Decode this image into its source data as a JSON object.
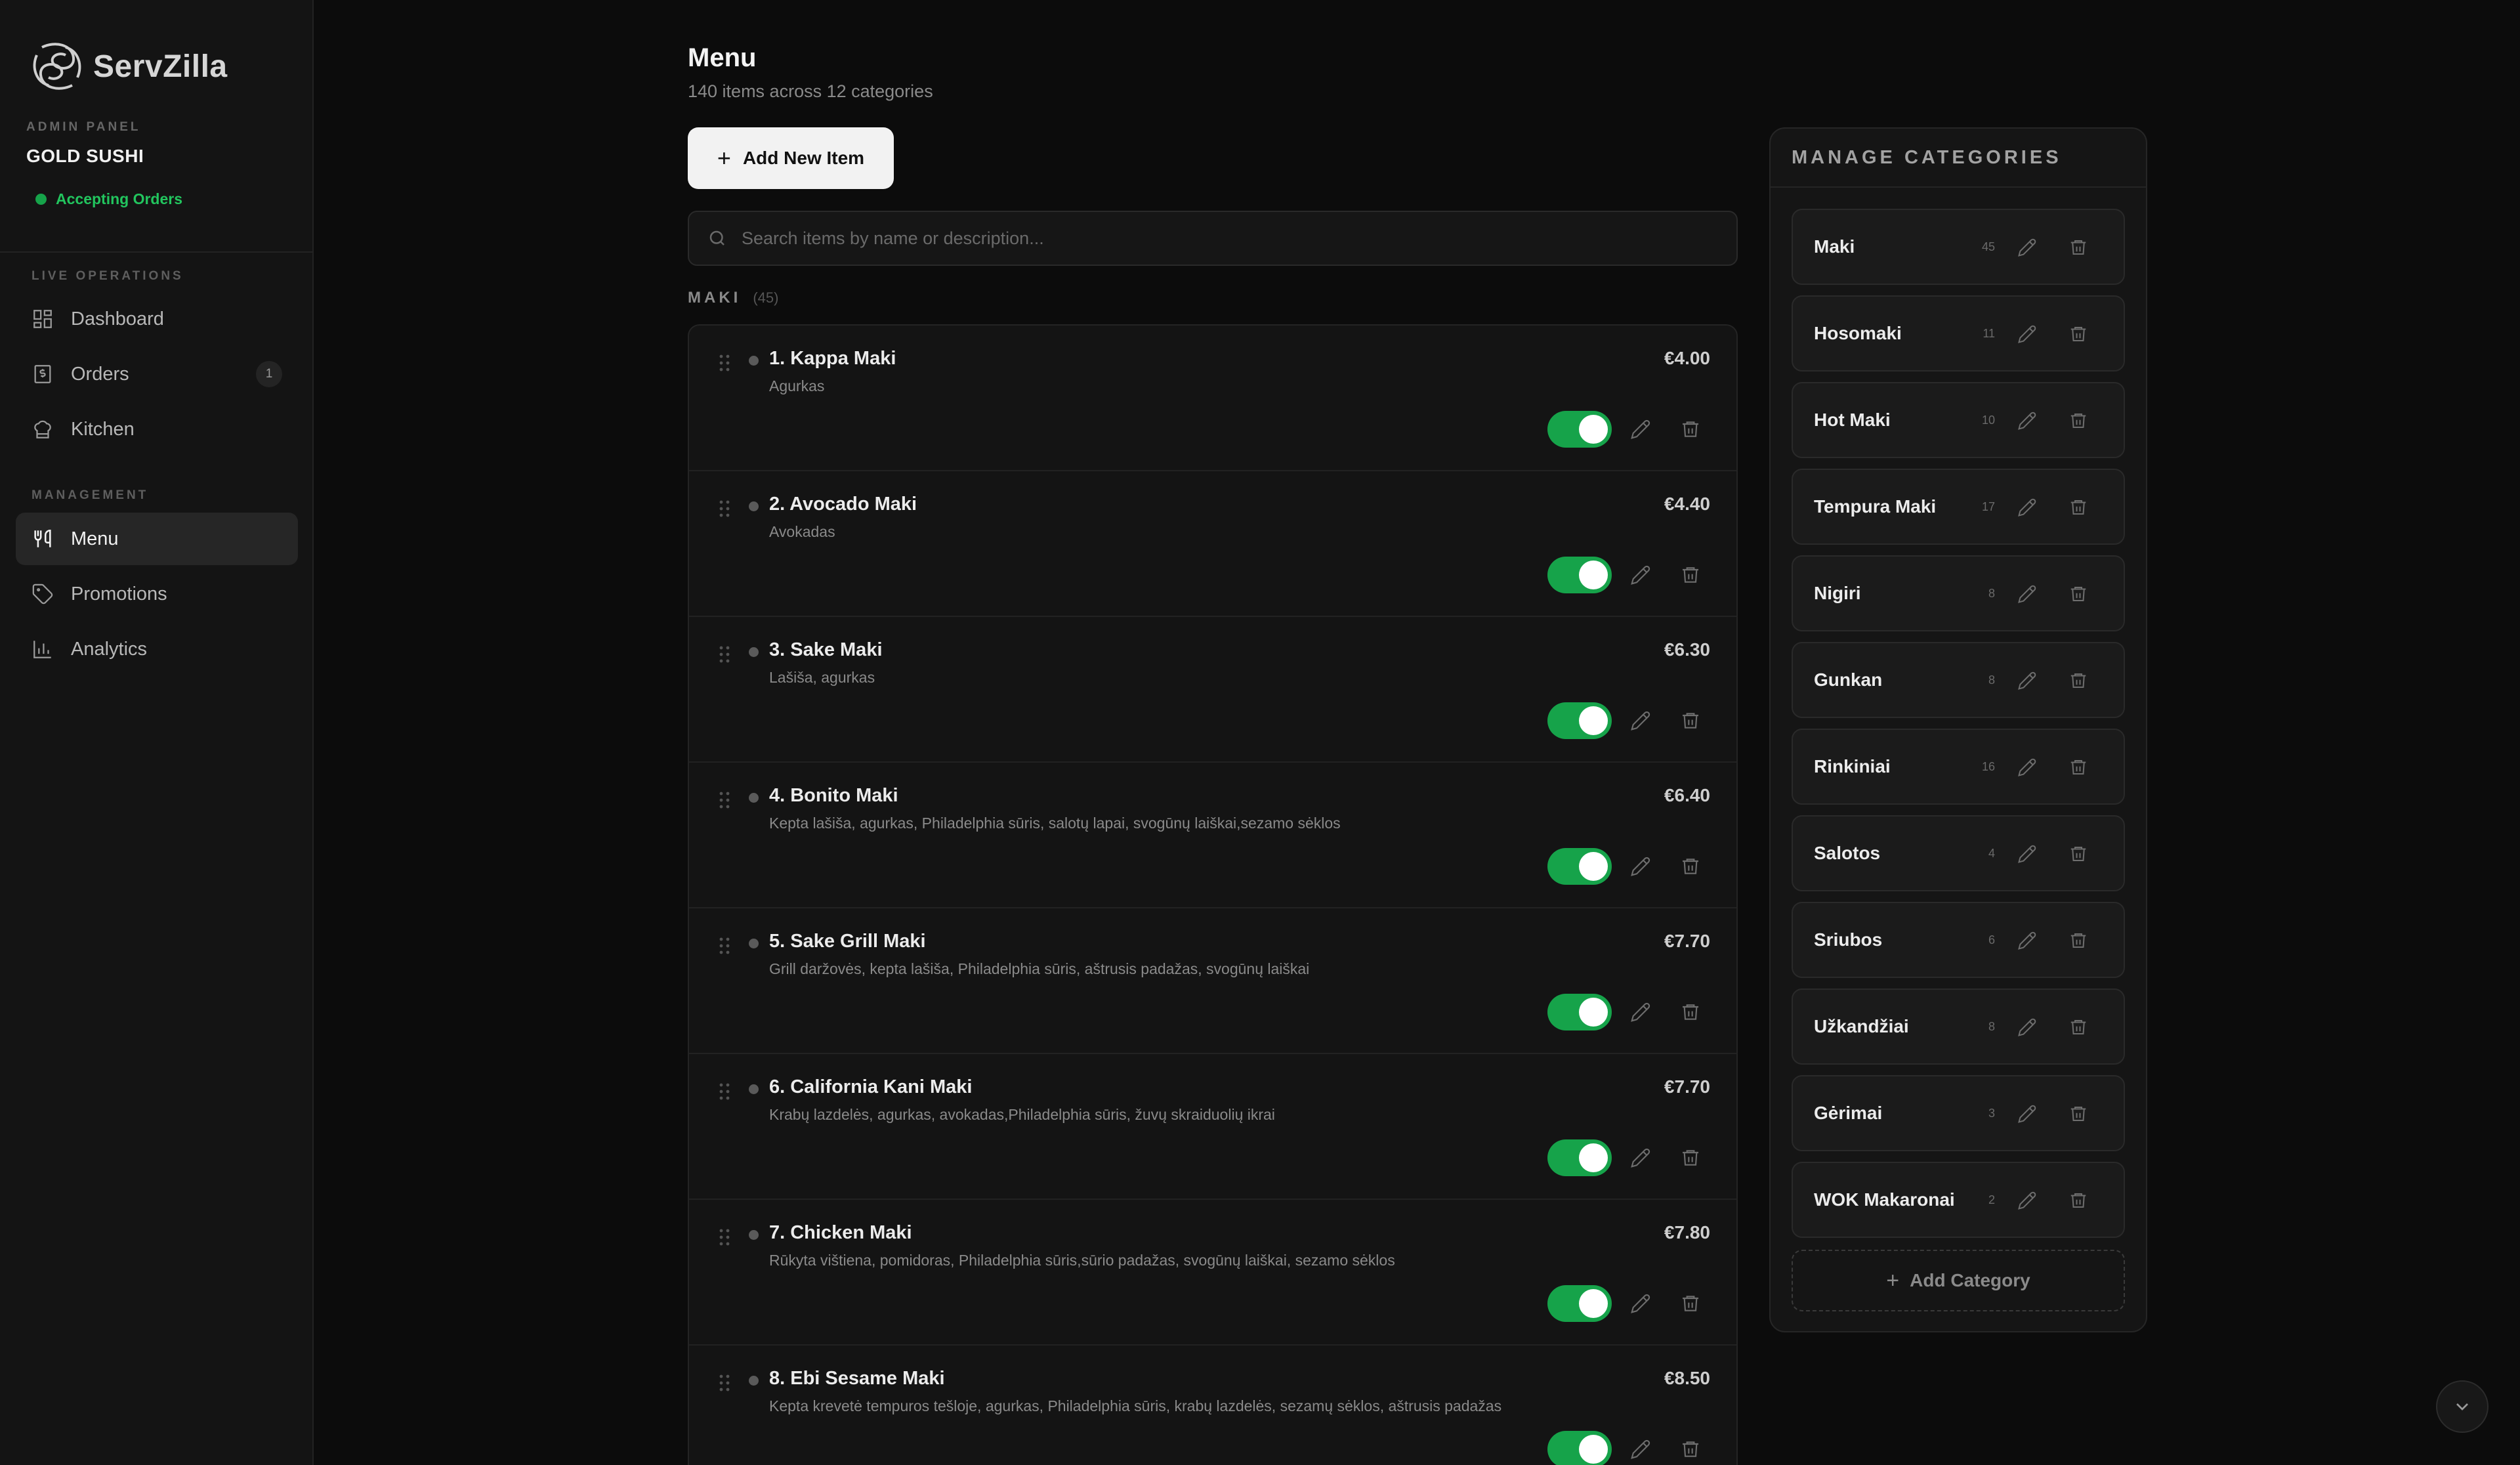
{
  "brand": {
    "name": "ServZilla"
  },
  "sidebar": {
    "admin_label": "ADMIN PANEL",
    "restaurant": "GOLD SUSHI",
    "status": "Accepting Orders",
    "status_color": "#16a34a",
    "sections": [
      {
        "label": "LIVE OPERATIONS"
      },
      {
        "label": "MANAGEMENT"
      }
    ],
    "items": [
      {
        "label": "Dashboard",
        "icon": "dashboard-icon"
      },
      {
        "label": "Orders",
        "icon": "receipt-icon",
        "badge": "1"
      },
      {
        "label": "Kitchen",
        "icon": "chef-hat-icon"
      },
      {
        "label": "Menu",
        "icon": "utensils-icon",
        "active": true
      },
      {
        "label": "Promotions",
        "icon": "tag-icon"
      },
      {
        "label": "Analytics",
        "icon": "bar-chart-icon"
      }
    ]
  },
  "main": {
    "title": "Menu",
    "subtitle": "140 items across 12 categories",
    "add_button": "Add New Item",
    "search_placeholder": "Search items by name or description...",
    "category_heading": "MAKI",
    "category_count": "(45)",
    "items": [
      {
        "name": "1. Kappa Maki",
        "desc": "Agurkas",
        "price": "€4.00",
        "enabled": true
      },
      {
        "name": "2. Avocado Maki",
        "desc": "Avokadas",
        "price": "€4.40",
        "enabled": true
      },
      {
        "name": "3. Sake Maki",
        "desc": "Lašiša, agurkas",
        "price": "€6.30",
        "enabled": true
      },
      {
        "name": "4. Bonito Maki",
        "desc": "Kepta lašiša, agurkas, Philadelphia sūris, salotų lapai, svogūnų laiškai,sezamo sėklos",
        "price": "€6.40",
        "enabled": true
      },
      {
        "name": "5. Sake Grill Maki",
        "desc": "Grill daržovės, kepta lašiša, Philadelphia sūris, aštrusis padažas, svogūnų laiškai",
        "price": "€7.70",
        "enabled": true
      },
      {
        "name": "6. California Kani Maki",
        "desc": "Krabų lazdelės, agurkas, avokadas,Philadelphia sūris, žuvų skraiduolių ikrai",
        "price": "€7.70",
        "enabled": true
      },
      {
        "name": "7. Chicken Maki",
        "desc": "Rūkyta vištiena, pomidoras, Philadelphia sūris,sūrio padažas, svogūnų laiškai, sezamo sėklos",
        "price": "€7.80",
        "enabled": true
      },
      {
        "name": "8. Ebi Sesame Maki",
        "desc": "Kepta krevetė tempuros tešloje, agurkas, Philadelphia sūris, krabų lazdelės, sezamų sėklos, aštrusis padažas",
        "price": "€8.50",
        "enabled": true
      }
    ]
  },
  "categories_panel": {
    "title": "MANAGE CATEGORIES",
    "add_label": "Add Category",
    "categories": [
      {
        "name": "Maki",
        "count": "45"
      },
      {
        "name": "Hosomaki",
        "count": "11"
      },
      {
        "name": "Hot Maki",
        "count": "10"
      },
      {
        "name": "Tempura Maki",
        "count": "17"
      },
      {
        "name": "Nigiri",
        "count": "8"
      },
      {
        "name": "Gunkan",
        "count": "8"
      },
      {
        "name": "Rinkiniai",
        "count": "16"
      },
      {
        "name": "Salotos",
        "count": "4"
      },
      {
        "name": "Sriubos",
        "count": "6"
      },
      {
        "name": "Užkandžiai",
        "count": "8"
      },
      {
        "name": "Gėrimai",
        "count": "3"
      },
      {
        "name": "WOK Makaronai",
        "count": "2"
      }
    ]
  },
  "colors": {
    "accent_green": "#16a34a",
    "background": "#0c0c0c"
  }
}
